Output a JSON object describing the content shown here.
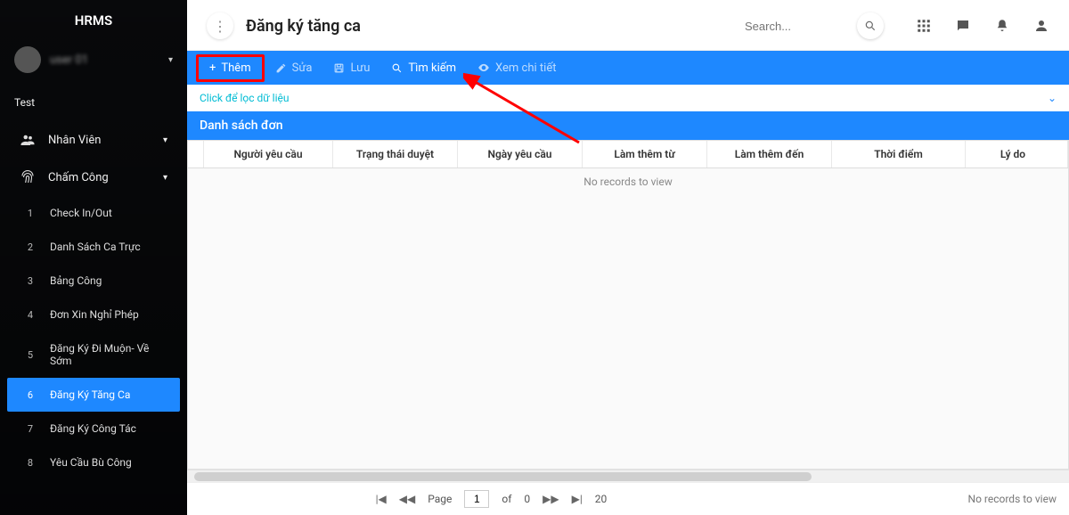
{
  "sidebar": {
    "brand": "HRMS",
    "user_name": "user 01",
    "top_label": "Test",
    "groups": [
      {
        "icon": "people",
        "label": "Nhân Viên"
      },
      {
        "icon": "fingerprint",
        "label": "Chấm Công"
      }
    ],
    "items": [
      {
        "num": "1",
        "label": "Check In/Out"
      },
      {
        "num": "2",
        "label": "Danh Sách Ca Trực"
      },
      {
        "num": "3",
        "label": "Bảng Công"
      },
      {
        "num": "4",
        "label": "Đơn Xin Nghỉ Phép"
      },
      {
        "num": "5",
        "label": "Đăng Ký Đi Muộn- Về Sớm"
      },
      {
        "num": "6",
        "label": "Đăng Ký Tăng Ca"
      },
      {
        "num": "7",
        "label": "Đăng Ký Công Tác"
      },
      {
        "num": "8",
        "label": "Yêu Cầu Bù Công"
      }
    ],
    "active_index": 5
  },
  "header": {
    "title": "Đăng ký tăng ca",
    "search_placeholder": "Search..."
  },
  "toolbar": {
    "add": "Thêm",
    "edit": "Sửa",
    "save": "Lưu",
    "search": "Tìm kiếm",
    "detail": "Xem chi tiết"
  },
  "filter_row": {
    "label": "Click để lọc dữ liệu"
  },
  "section": {
    "title": "Danh sách đơn"
  },
  "grid": {
    "columns": [
      "Người yêu cầu",
      "Trạng thái duyệt",
      "Ngày yêu cầu",
      "Làm thêm từ",
      "Làm thêm đến",
      "Thời điểm",
      "Lý do"
    ],
    "empty": "No records to view"
  },
  "pager": {
    "page_label": "Page",
    "page": "1",
    "of_label": "of",
    "total": "0",
    "page_size": "20",
    "status": "No records to view"
  }
}
